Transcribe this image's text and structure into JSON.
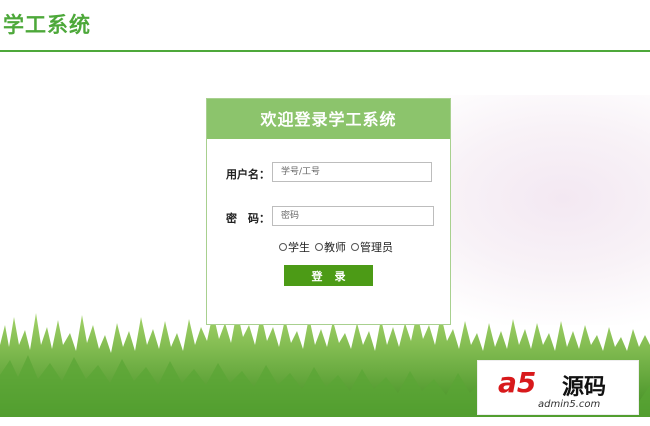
{
  "header": {
    "title": "学工系统"
  },
  "login": {
    "title": "欢迎登录学工系统",
    "username_label": "用户名：",
    "username_placeholder": "学号/工号",
    "password_label": "密　码：",
    "password_placeholder": "密码",
    "roles": [
      "学生",
      "教师",
      "管理员"
    ],
    "submit_label": "登录"
  },
  "watermark": {
    "logo": "a5",
    "text": "源码",
    "url": "admin5.com"
  },
  "colors": {
    "brand_green": "#4da83a",
    "header_green": "#8cc46c",
    "button_green": "#4c9b16"
  }
}
